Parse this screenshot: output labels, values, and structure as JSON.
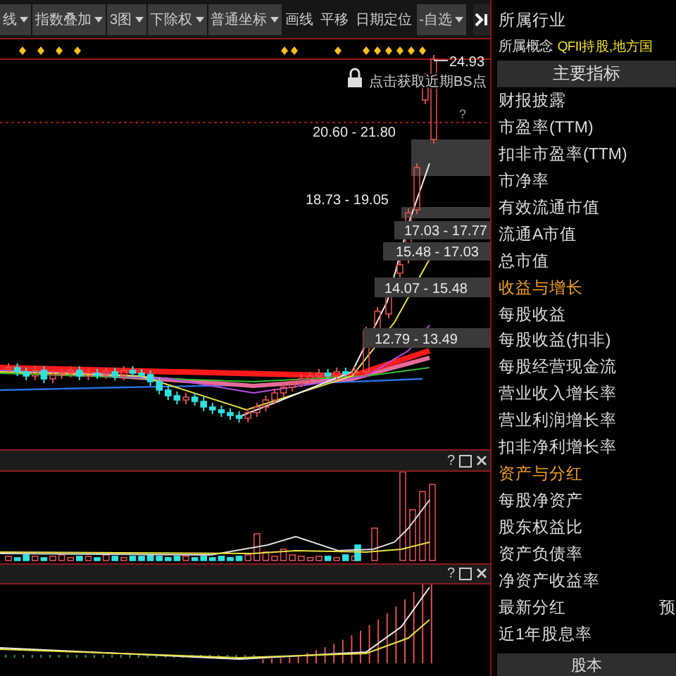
{
  "toolbar": {
    "items": [
      {
        "label": "线",
        "dropdown": true
      },
      {
        "label": "指数叠加",
        "dropdown": true
      },
      {
        "label": "3图",
        "dropdown": true
      },
      {
        "label": "下除权",
        "dropdown": true
      },
      {
        "label": "普通坐标",
        "dropdown": true
      },
      {
        "label": "画线",
        "dropdown": false
      },
      {
        "label": "平移",
        "dropdown": false
      },
      {
        "label": "日期定位",
        "dropdown": false
      },
      {
        "label": "-自选",
        "dropdown": true
      }
    ]
  },
  "chart": {
    "help": "?",
    "high_label": "24.93",
    "bs_hint": "点击获取近期BS点",
    "price_ranges": [
      {
        "label": "20.60 - 21.80"
      },
      {
        "label": "18.73 - 19.05"
      },
      {
        "label": "17.03 - 17.77"
      },
      {
        "label": "15.48 - 17.03"
      },
      {
        "label": "14.07 - 15.48"
      },
      {
        "label": "12.79 - 13.49"
      }
    ],
    "volume_header": {
      "help": "?"
    },
    "indicator_header": {
      "help": "?"
    }
  },
  "side_panel": {
    "industry_label": "所属行业",
    "concept_label": "所属概念",
    "concept_value": "QFII持股,地方国",
    "header": "主要指标",
    "rows": [
      {
        "kind": "row",
        "label": "财报披露"
      },
      {
        "kind": "row",
        "label": "市盈率(TTM)"
      },
      {
        "kind": "row",
        "label": "扣非市盈率(TTM)"
      },
      {
        "kind": "row",
        "label": "市净率"
      },
      {
        "kind": "row",
        "label": "有效流通市值"
      },
      {
        "kind": "row",
        "label": "流通A市值"
      },
      {
        "kind": "row",
        "label": "总市值"
      },
      {
        "kind": "section",
        "label": "收益与增长"
      },
      {
        "kind": "row",
        "label": "每股收益"
      },
      {
        "kind": "row",
        "label": "每股收益(扣非)"
      },
      {
        "kind": "row",
        "label": "每股经营现金流"
      },
      {
        "kind": "row",
        "label": "营业收入增长率"
      },
      {
        "kind": "row",
        "label": "营业利润增长率"
      },
      {
        "kind": "row",
        "label": "扣非净利增长率"
      },
      {
        "kind": "section",
        "label": "资产与分红"
      },
      {
        "kind": "row",
        "label": "每股净资产"
      },
      {
        "kind": "row",
        "label": "股东权益比"
      },
      {
        "kind": "row",
        "label": "资产负债率"
      },
      {
        "kind": "row",
        "label": "净资产收益率"
      },
      {
        "kind": "row",
        "label": "最新分红",
        "value": "预"
      },
      {
        "kind": "row",
        "label": "近1年股息率"
      }
    ],
    "footer_button": "股本"
  }
}
